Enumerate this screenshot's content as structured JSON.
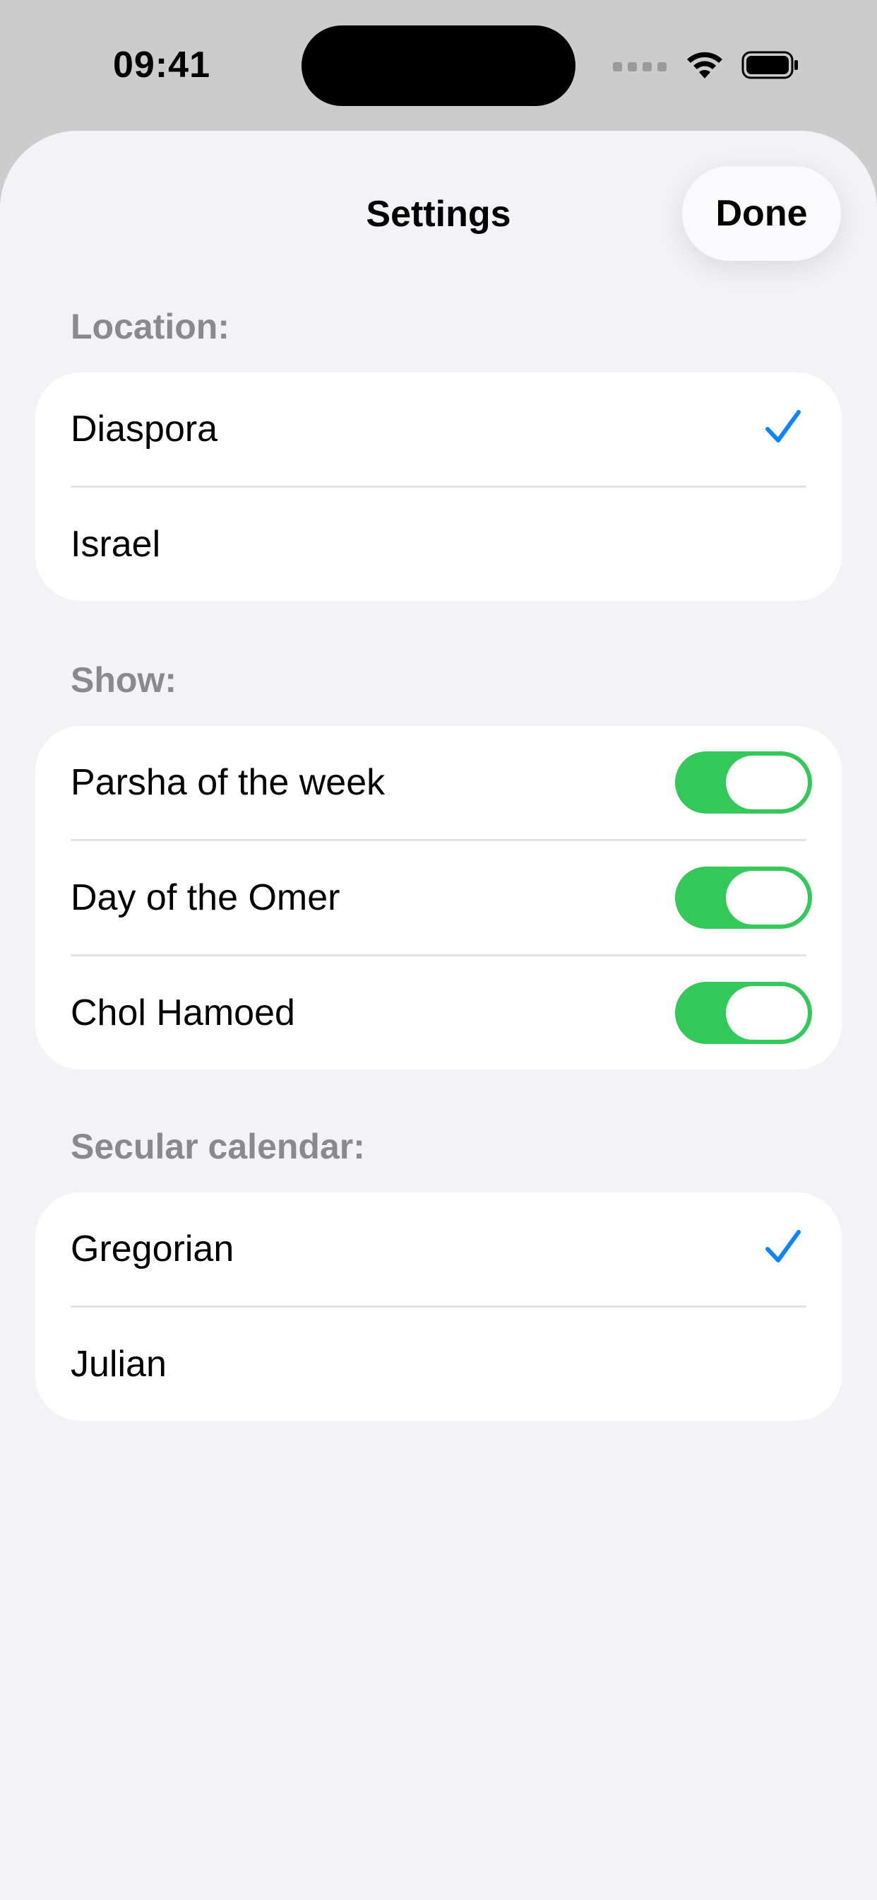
{
  "status_bar": {
    "time": "09:41",
    "icons": [
      "signal-dots-icon",
      "wifi-icon",
      "battery-icon"
    ]
  },
  "nav": {
    "title": "Settings",
    "done_label": "Done"
  },
  "location": {
    "header": "Location:",
    "options": [
      {
        "label": "Diaspora",
        "selected": true
      },
      {
        "label": "Israel",
        "selected": false
      }
    ]
  },
  "show": {
    "header": "Show:",
    "toggles": [
      {
        "label": "Parsha of the week",
        "on": true
      },
      {
        "label": "Day of the Omer",
        "on": true
      },
      {
        "label": "Chol Hamoed",
        "on": true
      }
    ]
  },
  "secular_calendar": {
    "header": "Secular calendar:",
    "options": [
      {
        "label": "Gregorian",
        "selected": true
      },
      {
        "label": "Julian",
        "selected": false
      }
    ]
  },
  "colors": {
    "accent": "#0a84ff",
    "toggle_on": "#34c759",
    "sheet_background": "#f2f2f7",
    "status_background": "#cccccc"
  }
}
